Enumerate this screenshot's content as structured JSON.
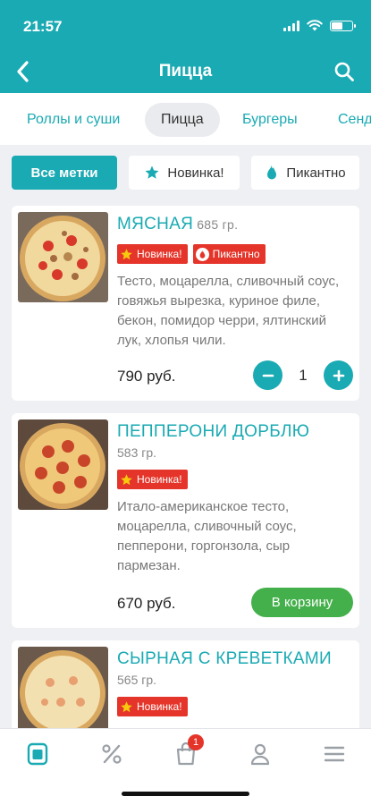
{
  "status": {
    "time": "21:57"
  },
  "header": {
    "title": "Пицца"
  },
  "tabs": [
    {
      "label": "Роллы и суши",
      "active": false
    },
    {
      "label": "Пицца",
      "active": true
    },
    {
      "label": "Бургеры",
      "active": false
    },
    {
      "label": "Сендвичи",
      "active": false
    }
  ],
  "filters": [
    {
      "label": "Все метки",
      "active": true
    },
    {
      "label": "Новинка!",
      "icon": "star-icon"
    },
    {
      "label": "Пикантно",
      "icon": "fire-icon"
    }
  ],
  "products": [
    {
      "name": "МЯСНАЯ",
      "weight": "685 гр.",
      "badges": [
        "Новинка!",
        "Пикантно"
      ],
      "description": "Тесто, моцарелла, сливочный соус, говяжья вырезка, куриное филе, бекон, помидор черри, ялтинский лук, хлопья чили.",
      "price": "790 руб.",
      "quantity": "1"
    },
    {
      "name": "ПЕППЕРОНИ ДОРБЛЮ",
      "weight": "583 гр.",
      "badges": [
        "Новинка!"
      ],
      "description": "Итало-американское тесто, моцарелла, сливочный соус, пепперони, горгонзола, сыр пармезан.",
      "price": "670 руб.",
      "cart_label": "В корзину"
    },
    {
      "name": "СЫРНАЯ С КРЕВЕТКАМИ",
      "weight": "565 гр.",
      "badges": [
        "Новинка!"
      ]
    }
  ],
  "tabbar": {
    "items": [
      "menu-icon",
      "discount-icon",
      "cart-icon",
      "profile-icon",
      "hamburger-icon"
    ],
    "cart_count": "1"
  },
  "colors": {
    "accent": "#1aaab3",
    "badge": "#e5352a",
    "cart_button": "#44b04b"
  }
}
